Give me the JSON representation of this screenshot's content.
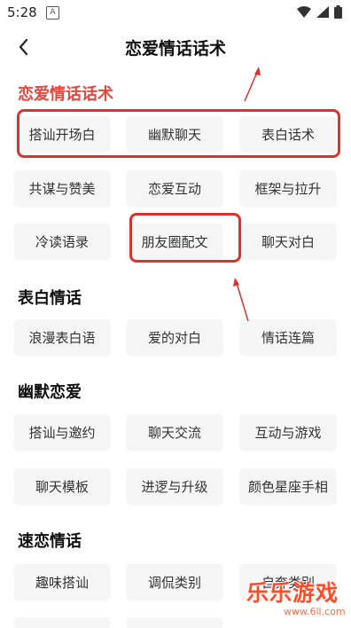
{
  "status_bar": {
    "time": "5:28",
    "notification_glyph": "A"
  },
  "header": {
    "title": "恋爱情话话术"
  },
  "sections": [
    {
      "title": "恋爱情话话术",
      "color": "#e8453c",
      "rows": [
        [
          "搭讪开场白",
          "幽默聊天",
          "表白话术"
        ],
        [
          "共谋与赞美",
          "恋爱互动",
          "框架与拉升"
        ],
        [
          "冷读语录",
          "朋友圈配文",
          "聊天对白"
        ]
      ]
    },
    {
      "title": "表白情话",
      "rows": [
        [
          "浪漫表白语",
          "爱的对白",
          "情话连篇"
        ]
      ]
    },
    {
      "title": "幽默恋爱",
      "rows": [
        [
          "搭讪与邀约",
          "聊天交流",
          "互动与游戏"
        ],
        [
          "聊天模板",
          "进逻与升级",
          "颜色星座手相"
        ]
      ]
    },
    {
      "title": "速恋情话",
      "rows": [
        [
          "趣味搭讪",
          "调侃类别",
          "自奔类别"
        ]
      ]
    }
  ],
  "annotation_color": "#d9332f",
  "watermark": {
    "text": "乐乐游戏",
    "url": "www.6ll.com"
  }
}
